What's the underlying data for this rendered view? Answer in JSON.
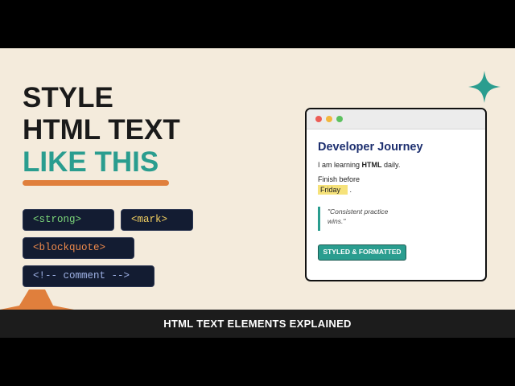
{
  "headline": {
    "line1": "STYLE",
    "line2": "HTML TEXT",
    "line3": "LIKE THIS"
  },
  "tags": {
    "strong": "<strong>",
    "mark": "<mark>",
    "blockquote": "<blockquote>",
    "comment": "<!-- comment -->"
  },
  "browser": {
    "heading": "Developer Journey",
    "line1_prefix": "I am learning ",
    "line1_strong": "HTML",
    "line1_suffix": " daily.",
    "line2": "Finish before",
    "line3_mark": "Friday",
    "line3_suffix": " .",
    "quote_line1": "\"Consistent practice",
    "quote_line2": "wins.\"",
    "button_label": "STYLED & FORMATTED"
  },
  "banner": {
    "text": "HTML TEXT ELEMENTS EXPLAINED"
  },
  "colors": {
    "background": "#f4ebdc",
    "accent_teal": "#2a9d8f",
    "accent_orange": "#e07f3c",
    "navy": "#131c32",
    "heading_blue": "#1d2f6f",
    "mark_yellow": "#f6e27a"
  },
  "icons": {
    "star": "four-point-star-icon",
    "orange_shape": "orange-triangle-shape"
  }
}
